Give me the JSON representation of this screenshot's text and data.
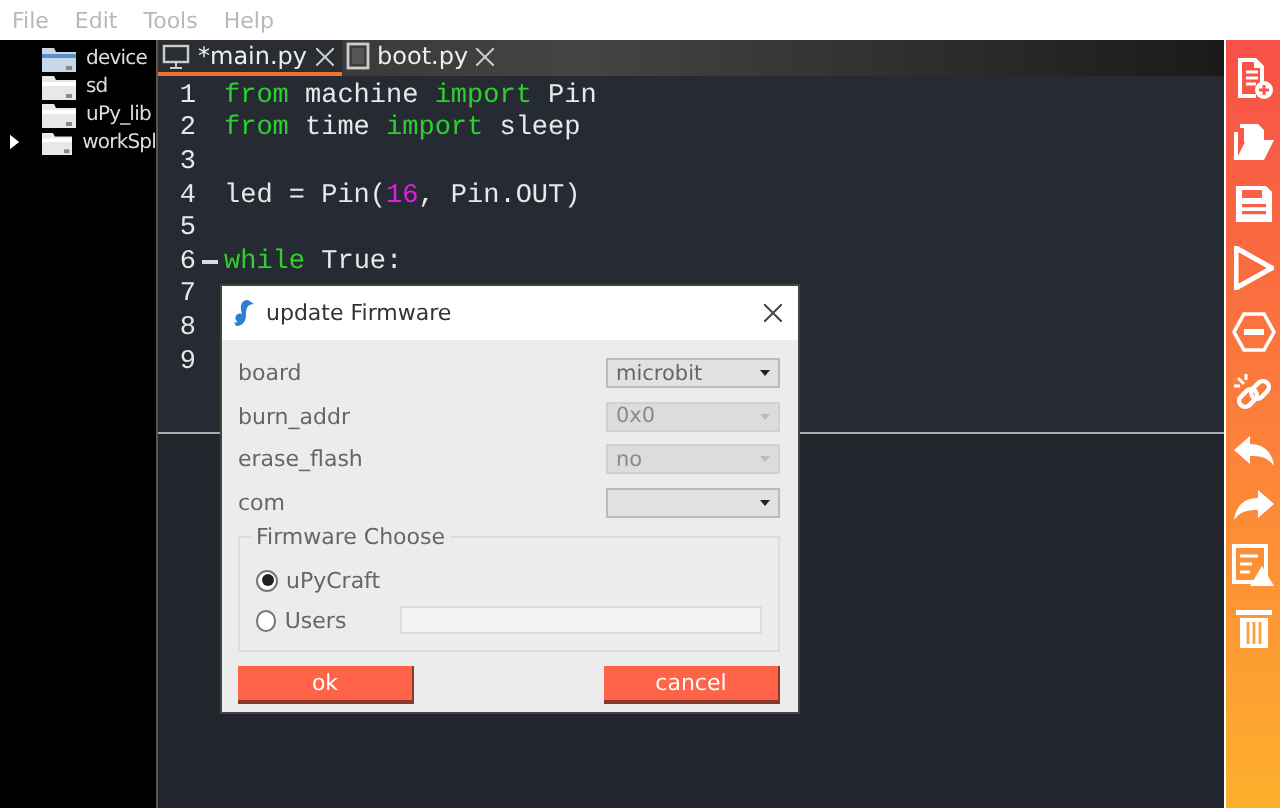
{
  "menu": [
    "File",
    "Edit",
    "Tools",
    "Help"
  ],
  "tree": [
    {
      "label": "device",
      "has_children": false
    },
    {
      "label": "sd",
      "has_children": false
    },
    {
      "label": "uPy_lib",
      "has_children": false
    },
    {
      "label": "workSpl",
      "has_children": true
    }
  ],
  "tabs": [
    {
      "label": "*main.py",
      "selected": true
    },
    {
      "label": "boot.py",
      "selected": false
    }
  ],
  "code": [
    {
      "number": "1",
      "fold": false,
      "tokens": [
        {
          "kind": "keyword",
          "text": "from"
        },
        {
          "kind": "plain",
          "text": " machine "
        },
        {
          "kind": "keyword",
          "text": "import"
        },
        {
          "kind": "plain",
          "text": " Pin"
        }
      ]
    },
    {
      "number": "2",
      "fold": false,
      "tokens": [
        {
          "kind": "keyword",
          "text": "from"
        },
        {
          "kind": "plain",
          "text": " time "
        },
        {
          "kind": "keyword",
          "text": "import"
        },
        {
          "kind": "plain",
          "text": " sleep"
        }
      ]
    },
    {
      "number": "3",
      "fold": false
    },
    {
      "number": "4",
      "fold": false,
      "tokens": [
        {
          "kind": "plain",
          "text": "led = Pin("
        },
        {
          "kind": "number",
          "text": "16"
        },
        {
          "kind": "plain",
          "text": ", Pin.OUT)"
        }
      ]
    },
    {
      "number": "5",
      "fold": false
    },
    {
      "number": "6",
      "fold": true,
      "tokens": [
        {
          "kind": "keyword",
          "text": "while"
        },
        {
          "kind": "plain",
          "text": " True:"
        }
      ]
    },
    {
      "number": "7",
      "fold": false
    },
    {
      "number": "8",
      "fold": false
    },
    {
      "number": "9",
      "fold": false
    }
  ],
  "dialog": {
    "title": "update Firmware",
    "fields": [
      {
        "label": "board",
        "value": "microbit",
        "disabled": false
      },
      {
        "label": "burn_addr",
        "value": "0x0",
        "disabled": true
      },
      {
        "label": "erase_flash",
        "value": "no",
        "disabled": true
      },
      {
        "label": "com",
        "disabled": false
      }
    ],
    "group": {
      "title": "Firmware Choose",
      "options": [
        {
          "label": "uPyCraft",
          "selected": true,
          "has_path": false
        },
        {
          "label": "Users",
          "selected": false,
          "has_path": true
        }
      ]
    },
    "buttons": [
      "ok",
      "cancel"
    ]
  }
}
